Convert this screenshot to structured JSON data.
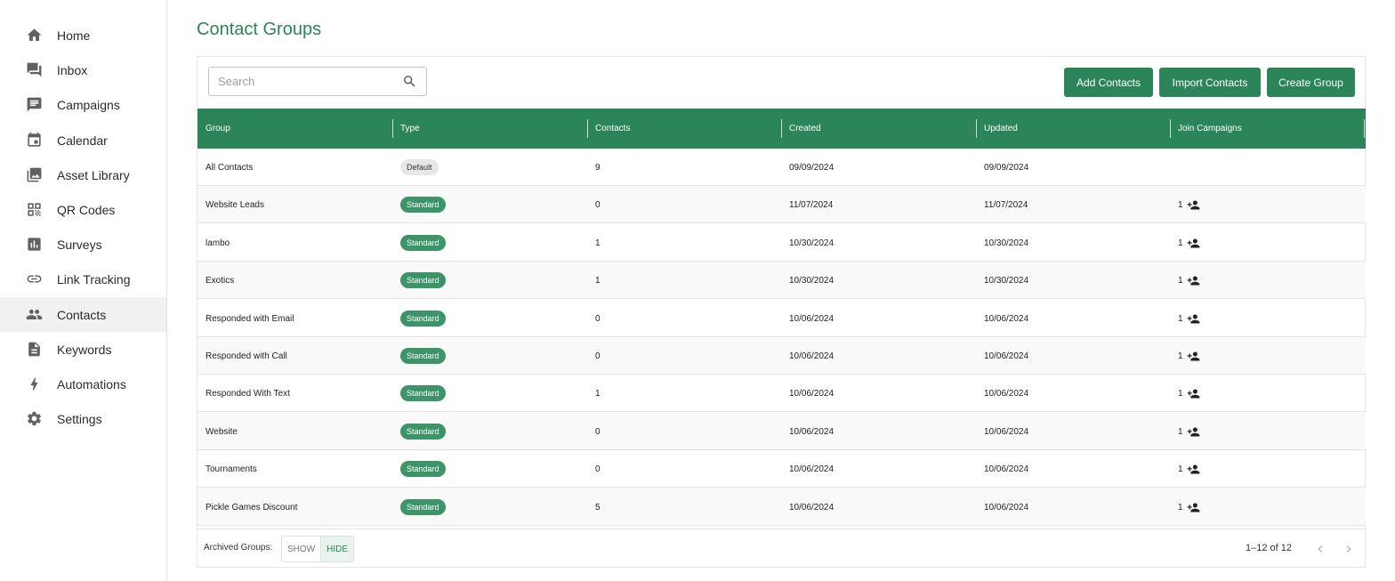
{
  "sidebar": {
    "items": [
      {
        "label": "Home",
        "icon": "home-icon"
      },
      {
        "label": "Inbox",
        "icon": "inbox-icon"
      },
      {
        "label": "Campaigns",
        "icon": "chat-icon"
      },
      {
        "label": "Calendar",
        "icon": "calendar-icon"
      },
      {
        "label": "Asset Library",
        "icon": "photo-library-icon"
      },
      {
        "label": "QR Codes",
        "icon": "qr-code-icon"
      },
      {
        "label": "Surveys",
        "icon": "bar-chart-icon"
      },
      {
        "label": "Link Tracking",
        "icon": "link-icon"
      },
      {
        "label": "Contacts",
        "icon": "people-icon",
        "active": true
      },
      {
        "label": "Keywords",
        "icon": "document-icon"
      },
      {
        "label": "Automations",
        "icon": "bolt-icon"
      },
      {
        "label": "Settings",
        "icon": "gear-icon"
      }
    ]
  },
  "page": {
    "title": "Contact Groups"
  },
  "toolbar": {
    "search_placeholder": "Search",
    "add_contacts": "Add Contacts",
    "import_contacts": "Import Contacts",
    "create_group": "Create Group"
  },
  "table": {
    "columns": [
      "Group",
      "Type",
      "Contacts",
      "Created",
      "Updated",
      "Join Campaigns"
    ],
    "rows": [
      {
        "group": "All Contacts",
        "type": "Default",
        "contacts": "9",
        "created": "09/09/2024",
        "updated": "09/09/2024",
        "join": ""
      },
      {
        "group": "Website Leads",
        "type": "Standard",
        "contacts": "0",
        "created": "11/07/2024",
        "updated": "11/07/2024",
        "join": "1"
      },
      {
        "group": "lambo",
        "type": "Standard",
        "contacts": "1",
        "created": "10/30/2024",
        "updated": "10/30/2024",
        "join": "1"
      },
      {
        "group": "Exotics",
        "type": "Standard",
        "contacts": "1",
        "created": "10/30/2024",
        "updated": "10/30/2024",
        "join": "1"
      },
      {
        "group": "Responded with Email",
        "type": "Standard",
        "contacts": "0",
        "created": "10/06/2024",
        "updated": "10/06/2024",
        "join": "1"
      },
      {
        "group": "Responded with Call",
        "type": "Standard",
        "contacts": "0",
        "created": "10/06/2024",
        "updated": "10/06/2024",
        "join": "1"
      },
      {
        "group": "Responded With Text",
        "type": "Standard",
        "contacts": "1",
        "created": "10/06/2024",
        "updated": "10/06/2024",
        "join": "1"
      },
      {
        "group": "Website",
        "type": "Standard",
        "contacts": "0",
        "created": "10/06/2024",
        "updated": "10/06/2024",
        "join": "1"
      },
      {
        "group": "Tournaments",
        "type": "Standard",
        "contacts": "0",
        "created": "10/06/2024",
        "updated": "10/06/2024",
        "join": "1"
      },
      {
        "group": "Pickle Games Discount",
        "type": "Standard",
        "contacts": "5",
        "created": "10/06/2024",
        "updated": "10/06/2024",
        "join": "1"
      }
    ]
  },
  "footer": {
    "archived_label": "Archived Groups:",
    "show": "SHOW",
    "hide": "HIDE",
    "selected": "HIDE",
    "pagination": "1–12 of 12"
  },
  "colors": {
    "accent": "#2b8559",
    "badge_standard": "#3c9468",
    "badge_default": "#e7e7e7"
  }
}
